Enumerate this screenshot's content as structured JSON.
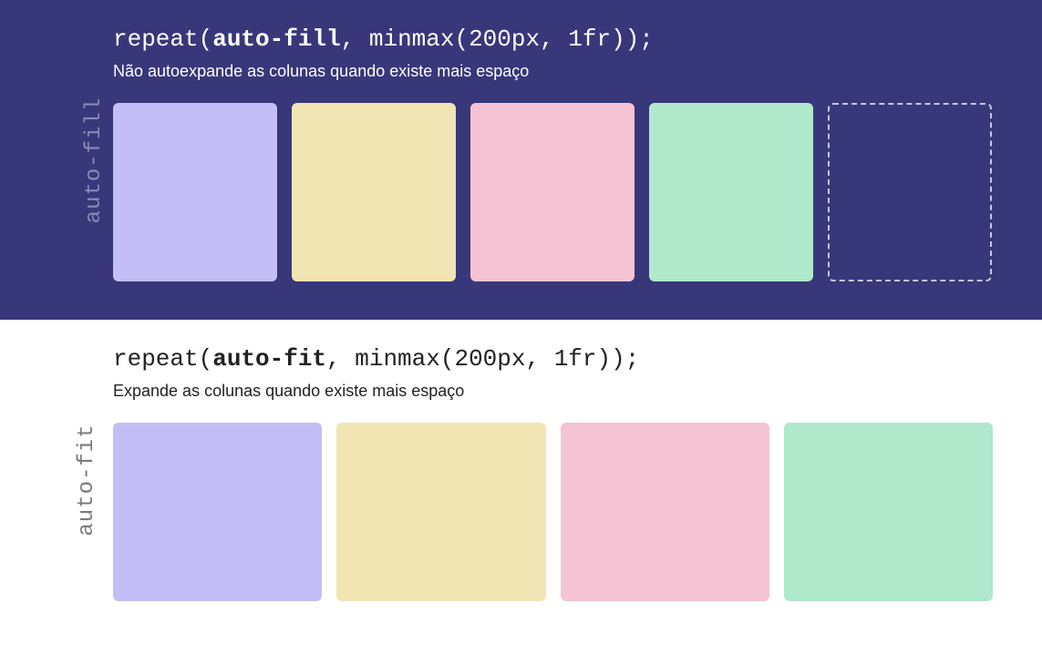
{
  "sections": {
    "fill": {
      "sideLabel": "auto-fill",
      "code_prefix": "repeat(",
      "code_keyword": "auto-fill",
      "code_suffix": ", minmax(200px, 1fr));",
      "description": "Não autoexpande as colunas quando existe mais espaço"
    },
    "fit": {
      "sideLabel": "auto-fit",
      "code_prefix": "repeat(",
      "code_keyword": "auto-fit",
      "code_suffix": ", minmax(200px, 1fr));",
      "description": "Expande as colunas quando existe mais espaço"
    }
  },
  "colors": {
    "box1": "#c3bef5",
    "box2": "#f1e5b3",
    "box3": "#f4c3d4",
    "box4": "#b0e9cc",
    "darkBg": "#37377a"
  }
}
